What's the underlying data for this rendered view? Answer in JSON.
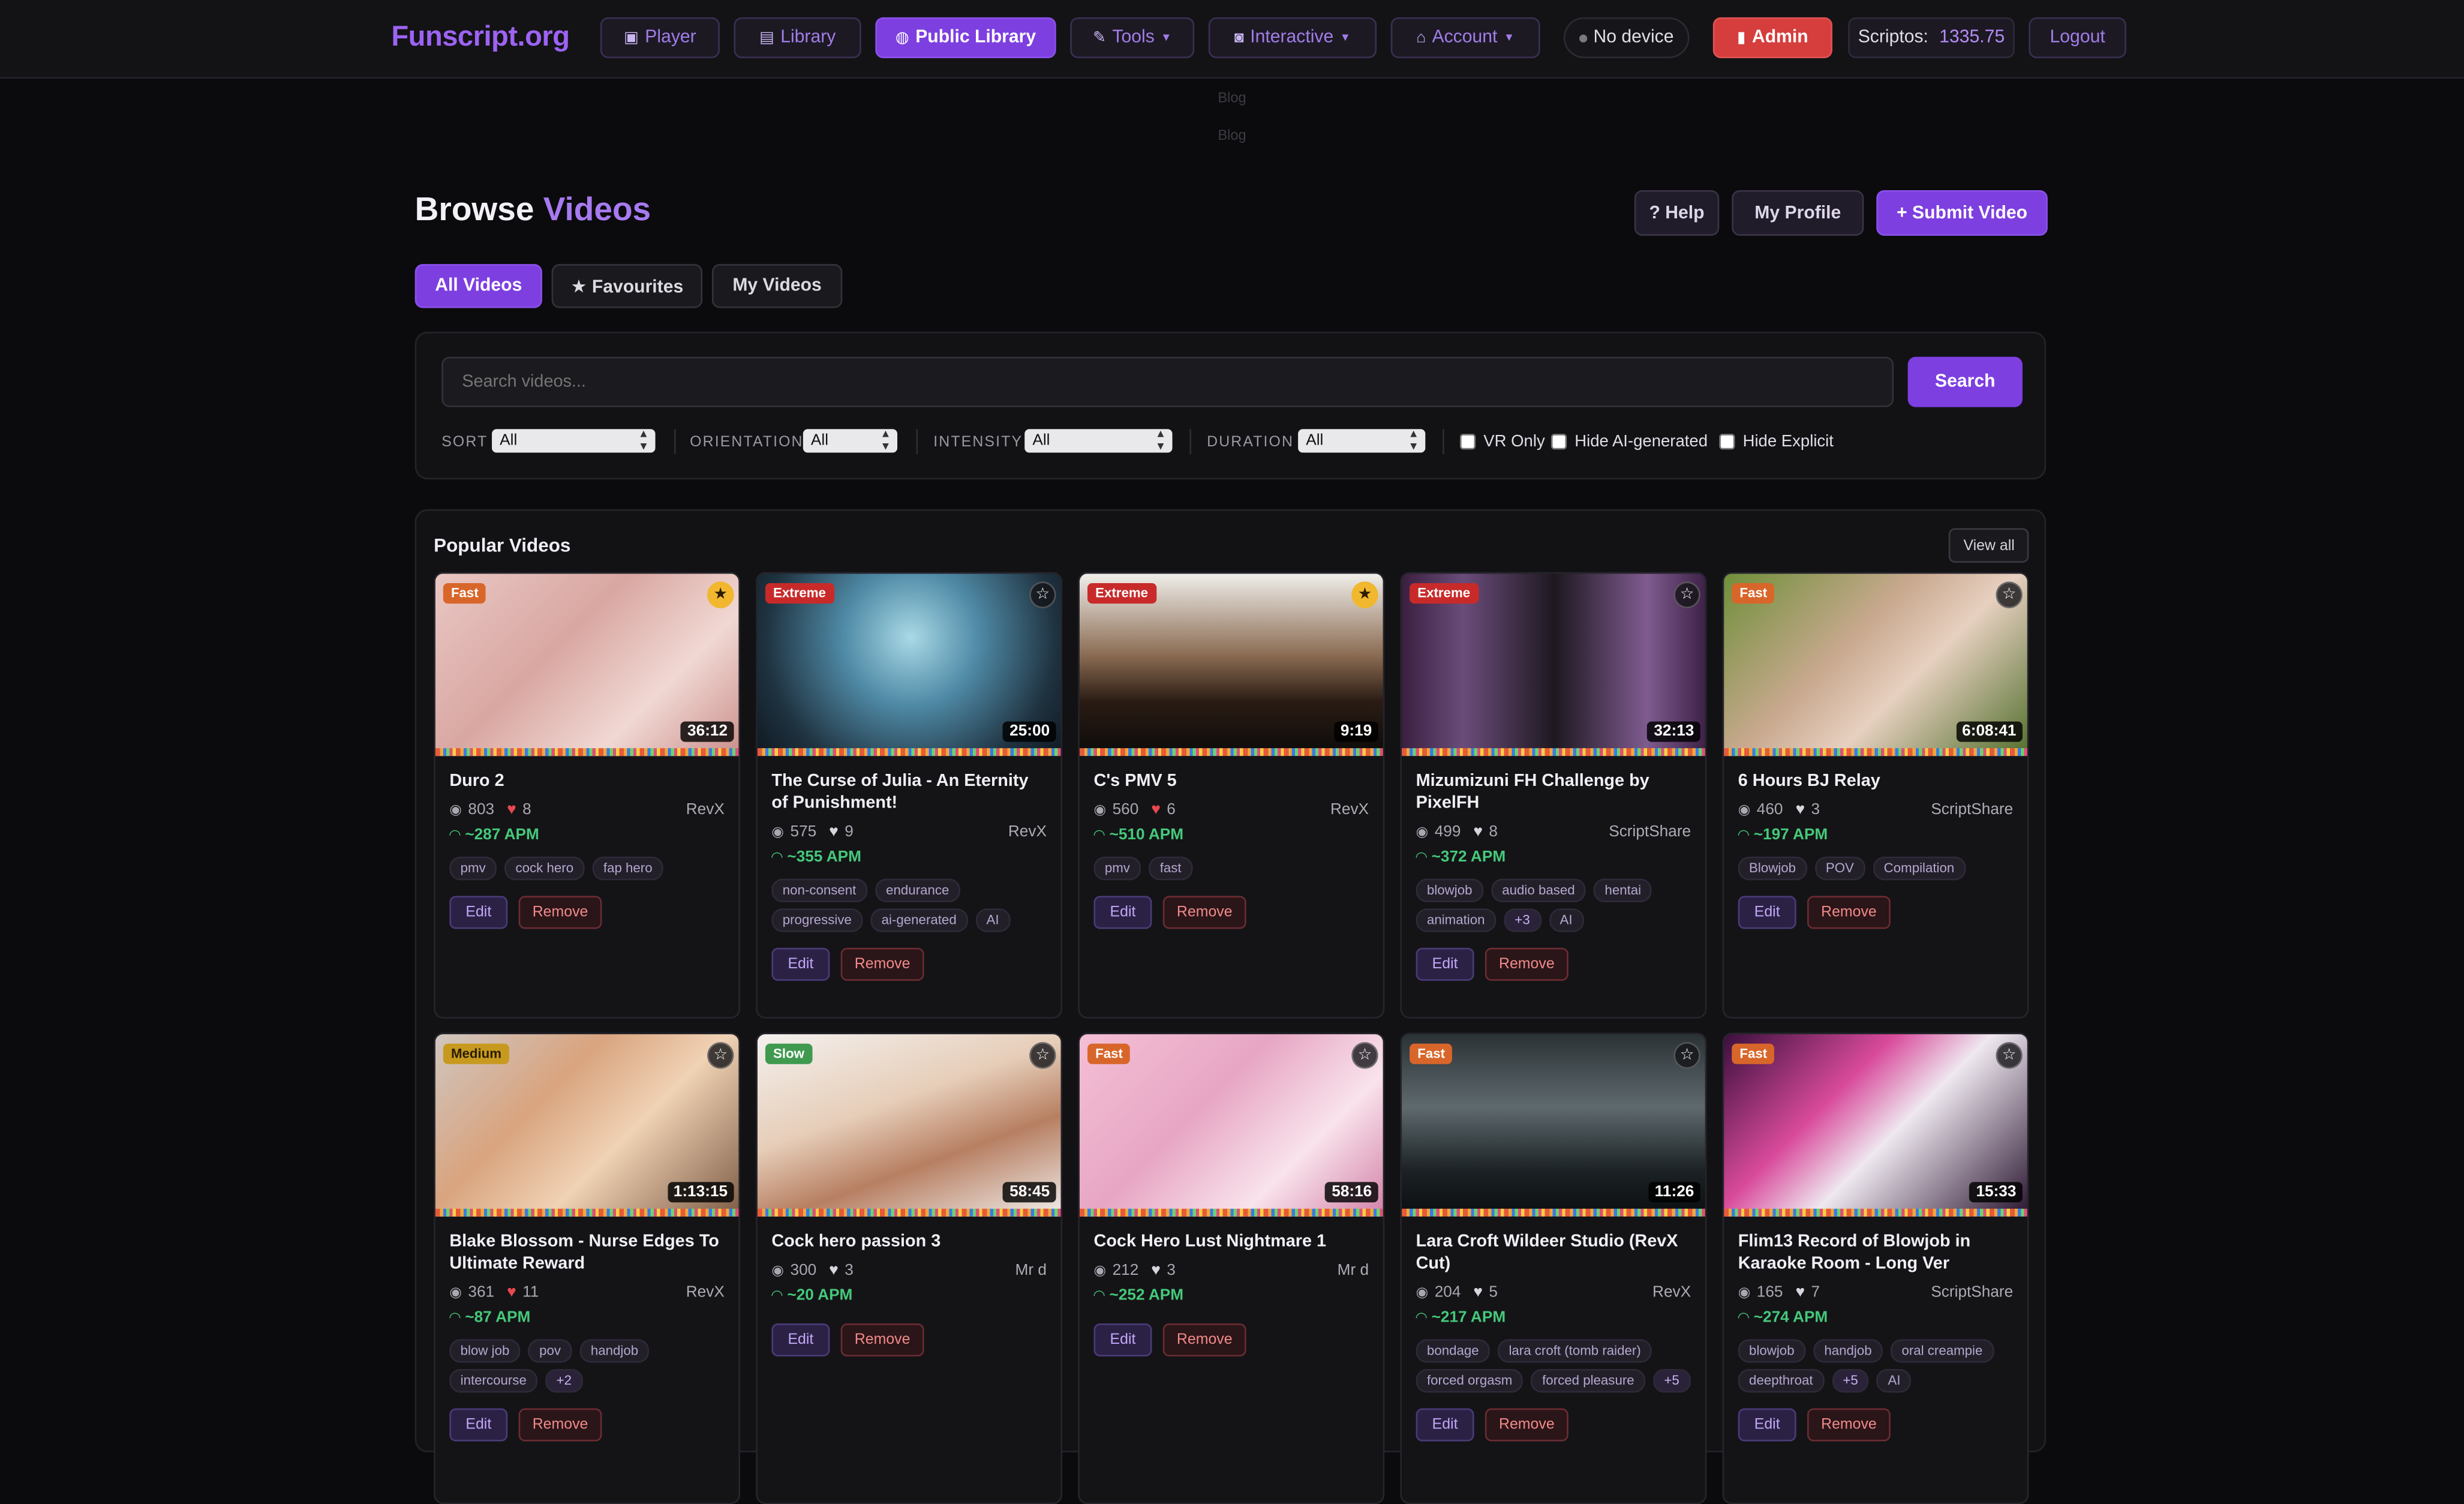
{
  "nav": {
    "logo": "Funscript.org",
    "player": "Player",
    "library": "Library",
    "public_library": "Public Library",
    "tools": "Tools",
    "interactive": "Interactive",
    "account": "Account",
    "device": "No device",
    "admin": "Admin",
    "scriptos_label": "Scriptos:",
    "scriptos_value": "1335.75",
    "logout": "Logout"
  },
  "blog": [
    "Blog",
    "Blog"
  ],
  "header": {
    "title_a": "Browse",
    "title_b": "Videos",
    "help": "? Help",
    "profile": "My Profile",
    "submit": "+ Submit Video"
  },
  "tabs": [
    "All Videos",
    "★ Favourites",
    "My Videos"
  ],
  "search": {
    "placeholder": "Search videos...",
    "button": "Search"
  },
  "filters": {
    "sort_label": "SORT",
    "sort_value": "All",
    "orientation_label": "ORIENTATION",
    "orientation_value": "All",
    "intensity_label": "INTENSITY",
    "intensity_value": "All",
    "duration_label": "DURATION",
    "duration_value": "All",
    "vr_only": "VR Only",
    "hide_ai": "Hide AI-generated",
    "hide_explicit": "Hide Explicit"
  },
  "section": {
    "title": "Popular Videos",
    "view_all": "View all"
  },
  "buttons": {
    "edit": "Edit",
    "remove": "Remove"
  },
  "colors": {
    "accent": "#7d3fe0",
    "admin": "#d63d3d",
    "apm": "#45c97a"
  },
  "videos": [
    {
      "title": "Duro 2",
      "badge": "Fast",
      "duration": "36:12",
      "views": "803",
      "likes": "8",
      "liked": true,
      "author": "RevX",
      "apm": "~287 APM",
      "favourite": true,
      "tags": [
        "pmv",
        "cock hero",
        "fap hero"
      ]
    },
    {
      "title": "The Curse of Julia - An Eternity of Punishment!",
      "badge": "Extreme",
      "duration": "25:00",
      "views": "575",
      "likes": "9",
      "liked": false,
      "author": "RevX",
      "apm": "~355 APM",
      "favourite": false,
      "tags": [
        "non-consent",
        "endurance",
        "progressive",
        "ai-generated",
        "AI"
      ]
    },
    {
      "title": "C's PMV 5",
      "badge": "Extreme",
      "duration": "9:19",
      "views": "560",
      "likes": "6",
      "liked": true,
      "author": "RevX",
      "apm": "~510 APM",
      "favourite": true,
      "tags": [
        "pmv",
        "fast"
      ]
    },
    {
      "title": "Mizumizuni FH Challenge by PixelFH",
      "badge": "Extreme",
      "duration": "32:13",
      "views": "499",
      "likes": "8",
      "liked": false,
      "author": "ScriptShare",
      "apm": "~372 APM",
      "favourite": false,
      "tags": [
        "blowjob",
        "audio based",
        "hentai",
        "animation",
        "+3",
        "AI"
      ]
    },
    {
      "title": "6 Hours BJ Relay",
      "badge": "Fast",
      "duration": "6:08:41",
      "views": "460",
      "likes": "3",
      "liked": false,
      "author": "ScriptShare",
      "apm": "~197 APM",
      "favourite": false,
      "tags": [
        "Blowjob",
        "POV",
        "Compilation"
      ]
    },
    {
      "title": "Blake Blossom - Nurse Edges To Ultimate Reward",
      "badge": "Medium",
      "duration": "1:13:15",
      "views": "361",
      "likes": "11",
      "liked": true,
      "author": "RevX",
      "apm": "~87 APM",
      "favourite": false,
      "tags": [
        "blow job",
        "pov",
        "handjob",
        "intercourse",
        "+2"
      ]
    },
    {
      "title": "Cock hero passion 3",
      "badge": "Slow",
      "duration": "58:45",
      "views": "300",
      "likes": "3",
      "liked": false,
      "author": "Mr d",
      "apm": "~20 APM",
      "favourite": false,
      "tags": []
    },
    {
      "title": "Cock Hero Lust Nightmare 1",
      "badge": "Fast",
      "duration": "58:16",
      "views": "212",
      "likes": "3",
      "liked": false,
      "author": "Mr d",
      "apm": "~252 APM",
      "favourite": false,
      "tags": []
    },
    {
      "title": "Lara Croft Wildeer Studio (RevX Cut)",
      "badge": "Fast",
      "duration": "11:26",
      "views": "204",
      "likes": "5",
      "liked": false,
      "author": "RevX",
      "apm": "~217 APM",
      "favourite": false,
      "tags": [
        "bondage",
        "lara croft (tomb raider)",
        "forced orgasm",
        "forced pleasure",
        "+5"
      ]
    },
    {
      "title": "Flim13 Record of Blowjob in Karaoke Room - Long Ver",
      "badge": "Fast",
      "duration": "15:33",
      "views": "165",
      "likes": "7",
      "liked": false,
      "author": "ScriptShare",
      "apm": "~274 APM",
      "favourite": false,
      "tags": [
        "blowjob",
        "handjob",
        "oral creampie",
        "deepthroat",
        "+5",
        "AI"
      ]
    }
  ]
}
